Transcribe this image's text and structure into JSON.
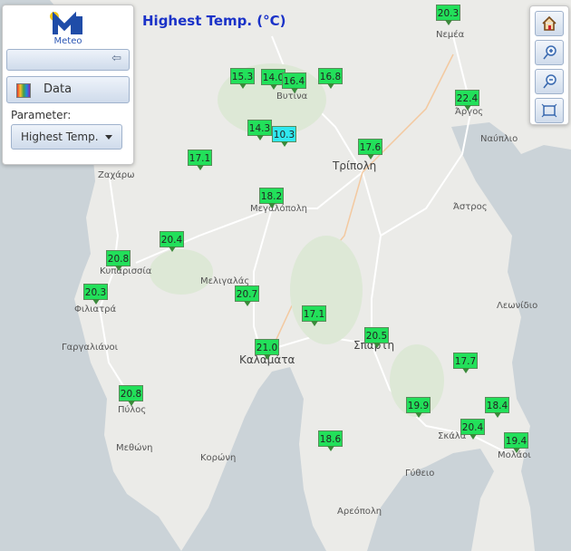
{
  "title": "Highest Temp. (°C)",
  "panel": {
    "logo_text": "Meteo",
    "data_button": "Data",
    "parameter_label": "Parameter:",
    "parameter_value": "Highest Temp."
  },
  "colors": {
    "marker_green": "#22e05a",
    "marker_light_green": "#55f07a",
    "marker_cyan": "#2fe8f0",
    "title_blue": "#1a32c8",
    "sea": "#c9d1d6"
  },
  "markers": [
    {
      "value": "20.3",
      "color": "green"
    },
    {
      "value": "15.3",
      "color": "green"
    },
    {
      "value": "14.0",
      "color": "green"
    },
    {
      "value": "16.4",
      "color": "green"
    },
    {
      "value": "16.8",
      "color": "green"
    },
    {
      "value": "22.4",
      "color": "green"
    },
    {
      "value": "14.3",
      "color": "green"
    },
    {
      "value": "10.3",
      "color": "cyan"
    },
    {
      "value": "17.6",
      "color": "green"
    },
    {
      "value": "17.1",
      "color": "green"
    },
    {
      "value": "18.2",
      "color": "green"
    },
    {
      "value": "20.4",
      "color": "green"
    },
    {
      "value": "20.8",
      "color": "green"
    },
    {
      "value": "20.3",
      "color": "green"
    },
    {
      "value": "20.7",
      "color": "green"
    },
    {
      "value": "17.1",
      "color": "green"
    },
    {
      "value": "20.5",
      "color": "green"
    },
    {
      "value": "21.0",
      "color": "green"
    },
    {
      "value": "17.7",
      "color": "green"
    },
    {
      "value": "20.8",
      "color": "green"
    },
    {
      "value": "19.9",
      "color": "green"
    },
    {
      "value": "18.4",
      "color": "green"
    },
    {
      "value": "20.4",
      "color": "green"
    },
    {
      "value": "19.4",
      "color": "green"
    },
    {
      "value": "18.6",
      "color": "green"
    }
  ],
  "places": [
    {
      "name": "Νεμέα"
    },
    {
      "name": "Βυτίνα"
    },
    {
      "name": "Άργος"
    },
    {
      "name": "Ναύπλιο"
    },
    {
      "name": "Τρίπολη"
    },
    {
      "name": "Ζαχάρω"
    },
    {
      "name": "Μεγαλόπολη"
    },
    {
      "name": "Άστρος"
    },
    {
      "name": "Κυπαρισσία"
    },
    {
      "name": "Μελιγαλάς"
    },
    {
      "name": "Φιλιατρά"
    },
    {
      "name": "Λεωνίδιο"
    },
    {
      "name": "Σπάρτη"
    },
    {
      "name": "Γαργαλιάνοι"
    },
    {
      "name": "Καλαμάτα"
    },
    {
      "name": "Πύλος"
    },
    {
      "name": "Σκάλα"
    },
    {
      "name": "Μεθώνη"
    },
    {
      "name": "Μολάοι"
    },
    {
      "name": "Κορώνη"
    },
    {
      "name": "Γύθειο"
    },
    {
      "name": "Αρεόπολη"
    }
  ]
}
